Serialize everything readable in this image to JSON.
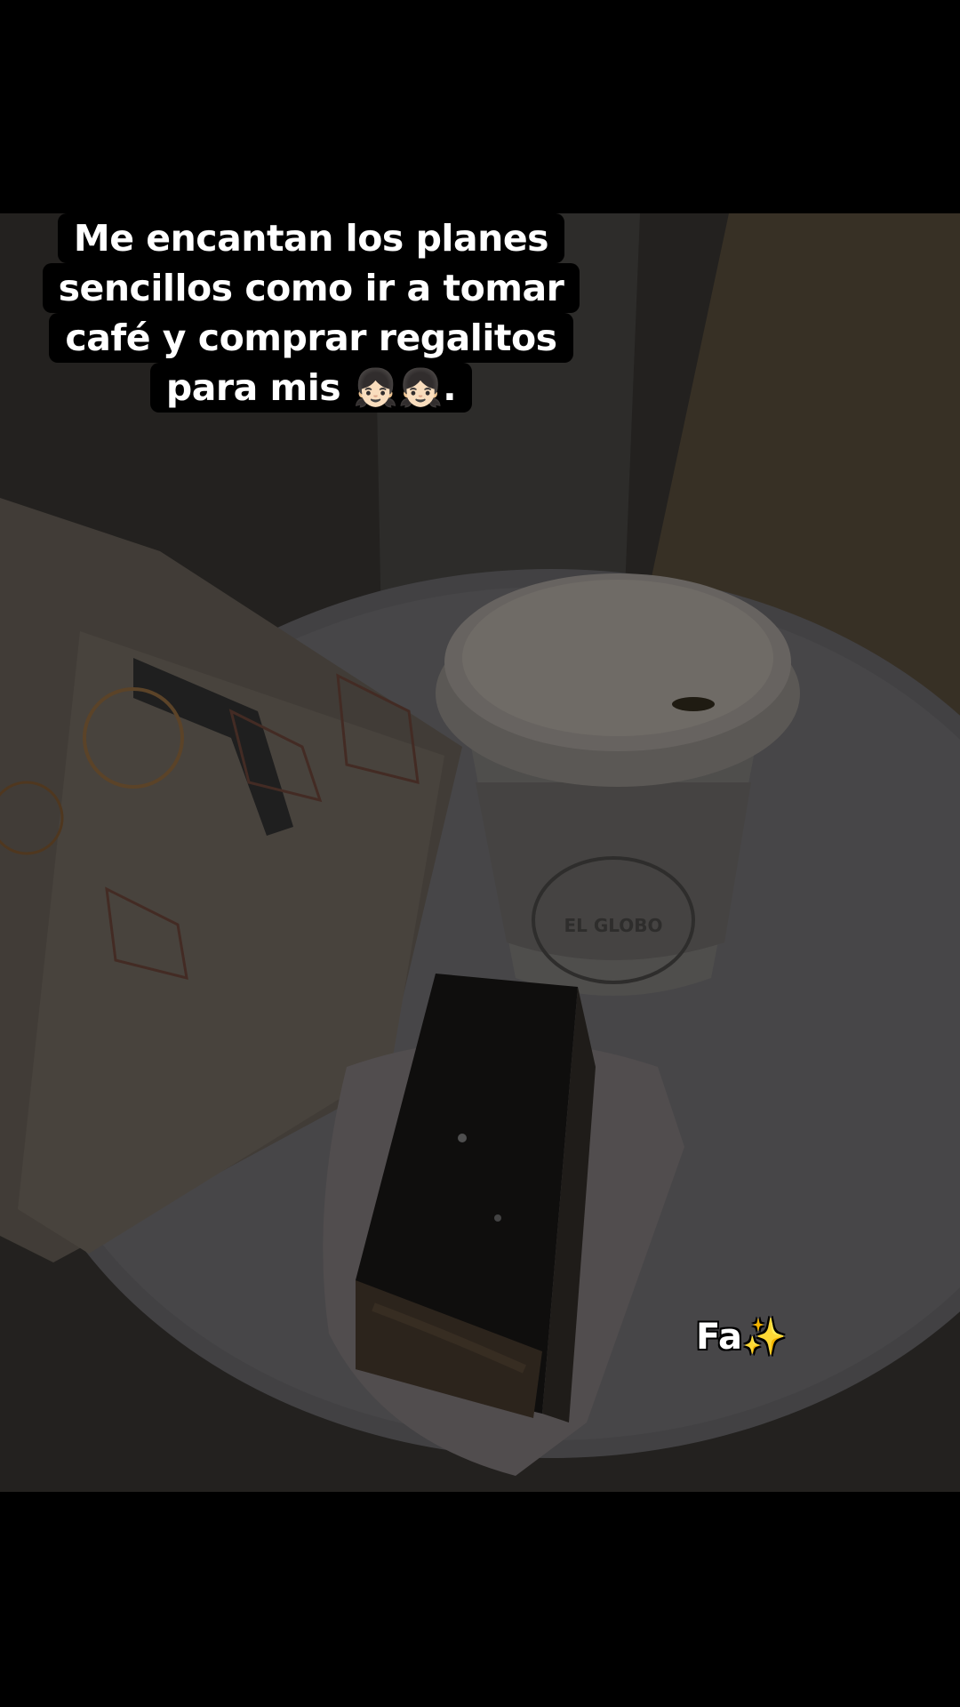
{
  "caption": {
    "line1": "Me encantan los planes",
    "line2": "sencillos como ir a tomar",
    "line3": "café y comprar regalitos",
    "line4": "para mis 👧🏻👧🏻."
  },
  "watermark": {
    "text": "Fa",
    "icon": "sparkles-icon",
    "glyph": "✨"
  },
  "photo": {
    "cup_brand": "EL GLOBO"
  }
}
